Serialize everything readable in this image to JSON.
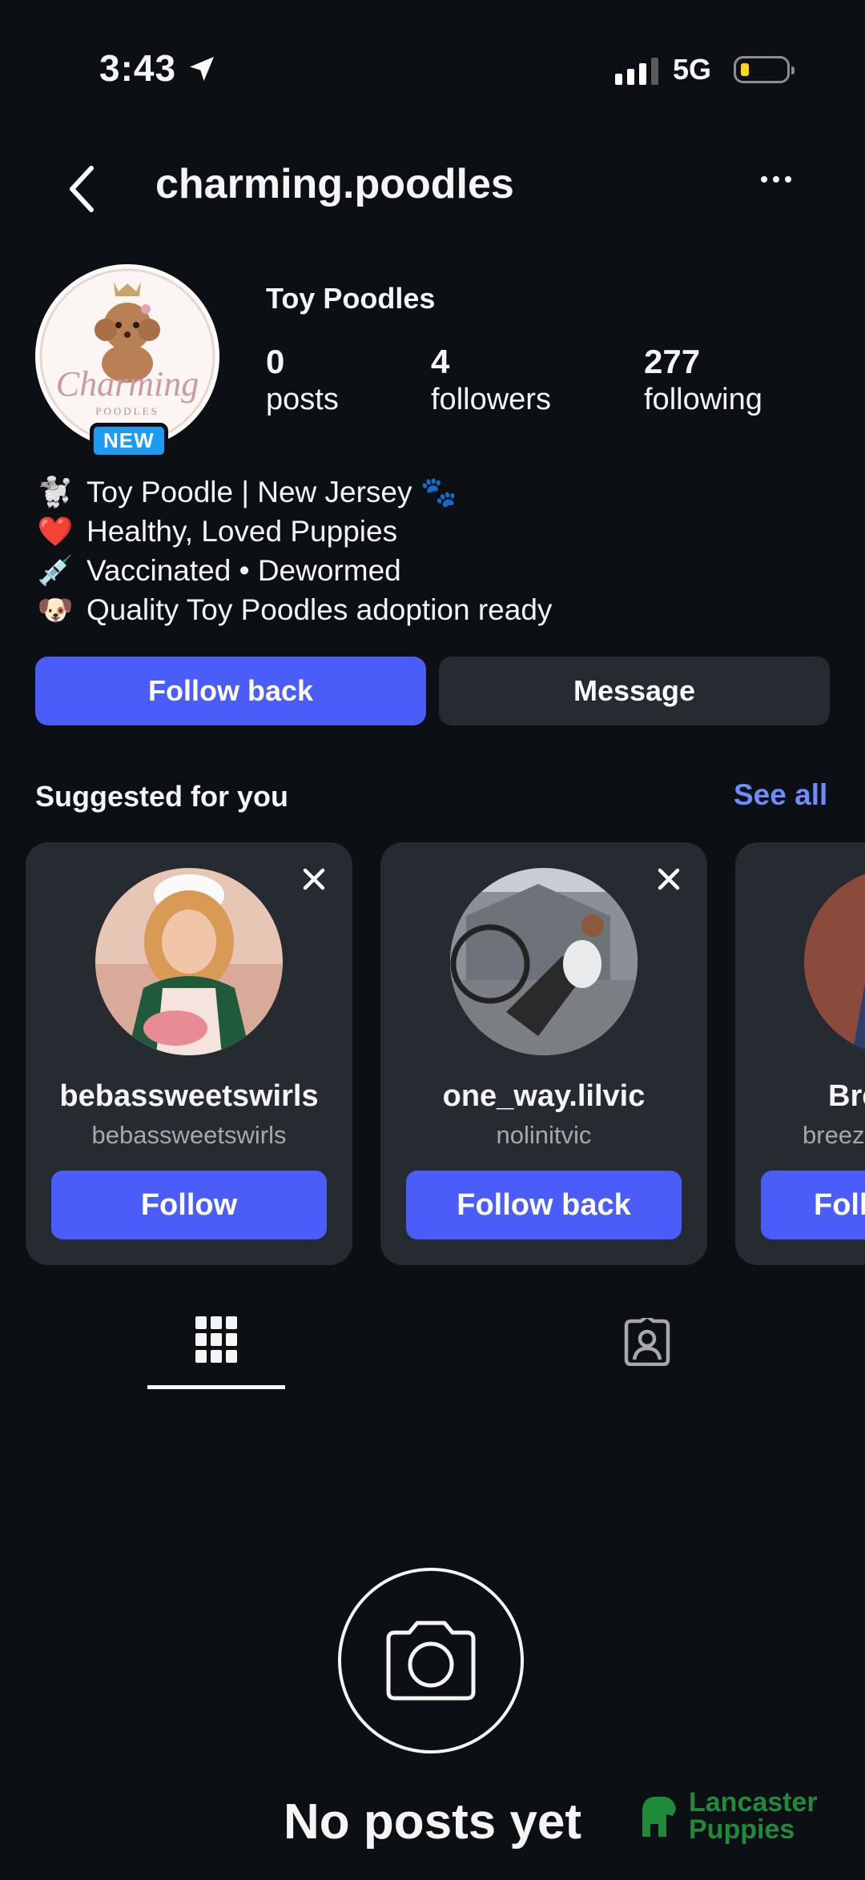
{
  "status_bar": {
    "time": "3:43",
    "network": "5G"
  },
  "header": {
    "username": "charming.poodles"
  },
  "profile": {
    "avatar_badge": "NEW",
    "display_name": "Toy Poodles",
    "stats": [
      {
        "value": "0",
        "label": "posts"
      },
      {
        "value": "4",
        "label": "followers"
      },
      {
        "value": "277",
        "label": "following"
      }
    ],
    "bio": [
      {
        "emoji": "🐩",
        "text": "Toy Poodle | New Jersey 🐾"
      },
      {
        "emoji": "❤️",
        "text": "Healthy, Loved Puppies"
      },
      {
        "emoji": "💉",
        "text": "Vaccinated • Dewormed"
      },
      {
        "emoji": "🐶",
        "text": "Quality Toy Poodles adoption ready"
      }
    ],
    "avatar_logo_text": "Charming",
    "avatar_logo_subtext": "POODLES"
  },
  "actions": {
    "follow_back": "Follow back",
    "message": "Message"
  },
  "suggested": {
    "title": "Suggested for you",
    "see_all": "See all",
    "cards": [
      {
        "name": "bebassweetswirls",
        "handle": "bebassweetswirls",
        "button": "Follow"
      },
      {
        "name": "one_way.lilvic",
        "handle": "nolinitvic",
        "button": "Follow back"
      },
      {
        "name": "Bre",
        "handle": "breez",
        "button": "Foll"
      }
    ]
  },
  "empty_state": {
    "title": "No posts yet"
  },
  "watermark": {
    "line1": "Lancaster",
    "line2": "Puppies"
  },
  "colors": {
    "background": "#0c1014",
    "accent": "#4a5df9",
    "link": "#6f8cff",
    "card": "#262a31"
  },
  "icons": [
    "location-arrow-icon",
    "signal-icon",
    "battery-icon",
    "back-chevron-icon",
    "more-icon",
    "close-icon",
    "grid-icon",
    "tagged-icon",
    "camera-icon"
  ]
}
